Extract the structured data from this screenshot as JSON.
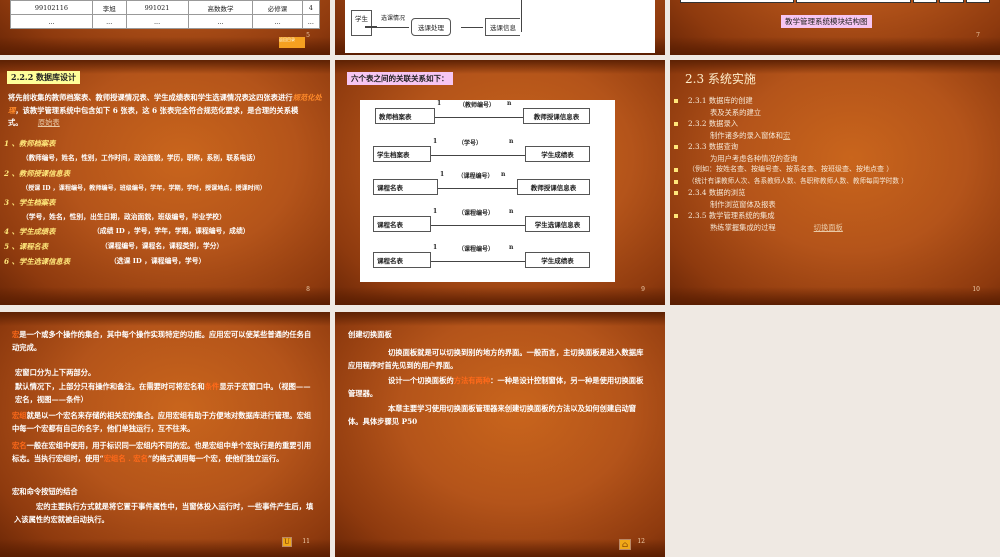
{
  "slide5": {
    "number": "5",
    "table_row1": [
      "99102116",
      "李旭",
      "991021",
      "高数数学",
      "必修课",
      "4"
    ],
    "table_row2": [
      "...",
      "...",
      "...",
      "...",
      "...",
      "..."
    ],
    "back_button": "返回目录"
  },
  "slide6": {
    "student": "学生",
    "flow1": "选课情况",
    "process": "选课处理",
    "store": "选课信息"
  },
  "slide7": {
    "number": "7",
    "caption": "教学管理系统模块结构图"
  },
  "slide8": {
    "number": "8",
    "title": "2.2.2  数据库设计",
    "intro_a": "将先前收集的教师档案表、教师授课情况表、学生成绩表和学生选课情况表这四张表进行",
    "intro_em": "规范化处理",
    "intro_b": "，该教学管理系统中包含如下 6 张表，这 6 张表完全符合规范化要求，是合理的关系模式。",
    "link": "原始表",
    "tables": [
      {
        "name": "1 、教师档案表",
        "fields": "（教师编号，姓名，性别，工作时间，政治面貌，学历，职称，系别，联系电话）"
      },
      {
        "name": "2 、教师授课信息表",
        "fields": "（授课 ID ，课程编号，教师编号，班级编号，学年，学期，学时，授课地点，授课时间）"
      },
      {
        "name": "3 、学生档案表",
        "fields": "（学号，姓名，性别，出生日期，政治面貌，班级编号，毕业学校）"
      },
      {
        "name": "4 、学生成绩表",
        "fields": "（成绩 ID ，学号，学年，学期，课程编号，成绩）"
      },
      {
        "name": "5 、课程名表",
        "fields": "（课程编号，课程名，课程类别，学分）"
      },
      {
        "name": "6 、学生选课信息表",
        "fields": "（选课 ID ，课程编号，学号）"
      }
    ]
  },
  "slide9": {
    "number": "9",
    "title": "六个表之间的关联关系如下：",
    "relations": [
      {
        "from": "教师档案表",
        "one": "1",
        "key": "（教师编号）",
        "many": "n",
        "to": "教师授课信息表"
      },
      {
        "from": "学生档案表",
        "one": "1",
        "key": "（学号）",
        "many": "n",
        "to": "学生成绩表"
      },
      {
        "from": "课程名表",
        "one": "1",
        "key": "（课程编号）",
        "many": "n",
        "to": "教师授课信息表"
      },
      {
        "from": "课程名表",
        "one": "1",
        "key": "（课程编号）",
        "many": "n",
        "to": "学生选课信息表"
      },
      {
        "from": "课程名表",
        "one": "1",
        "key": "（课程编号）",
        "many": "n",
        "to": "学生成绩表"
      }
    ]
  },
  "slide10": {
    "number": "10",
    "title": "2.3  系统实施",
    "items": [
      "2.3.1   数据库的创建",
      "表及关系的建立",
      "2.3.2   数据录入",
      "制作诸多的录入窗体和",
      "宏",
      "2.3.3   数据查询",
      "为用户考虑各种情况的查询",
      "（例如：按姓名查、按编号查、按系名查、按班级查、按地点查 ）",
      "（统计有课教师人次、各系教师人数、各职称教师人数、教师每周学时数 ）",
      "2.3.4   数据的浏览",
      "制作浏览窗体及报表",
      "2.3.5   教学管理系统的集成",
      "熟练掌握集成的过程",
      "切换面板"
    ]
  },
  "slide11": {
    "number": "11",
    "p1_em": "宏",
    "p1": "是一个或多个操作的集合，其中每个操作实现特定的功能。应用宏可以使某些普通的任务自动完成。",
    "p2": "宏窗口分为上下两部分。",
    "p3_a": "默认情况下，上部分只有操作和备注。在需要时可将宏名和",
    "p3_em": "条件",
    "p3_b": "显示于宏窗口中。（视图——宏名，视图——条件）",
    "p4_em": "宏组",
    "p4": "就是以一个宏名来存储的相关宏的集合。应用宏组有助于方便地对数据库进行管理。宏组中每一个宏都有自己的名字，他们单独运行，互不往来。",
    "p5_em": "宏名",
    "p5_a": "一般在宏组中使用，用于标识同一宏组内不同的宏。也是宏组中单个宏执行是的重要引用标志。当执行宏组时，使用“",
    "p5_em2": "宏组名 . 宏名",
    "p5_b": "”的格式调用每一个宏，使他们独立运行。",
    "p6": "宏和命令按钮的结合",
    "p7": "宏的主要执行方式就是将它置于事件属性中，当窗体投入运行时，一些事件产生后，填入该属性的宏就被启动执行。"
  },
  "slide12": {
    "number": "12",
    "title": "创建切换面板",
    "p1": "切换面板就是可以切换到别的地方的界面。一般而言，主切换面板是进入数据库应用程序时首先见到的用户界面。",
    "p2_a": "设计一个切换面板的",
    "p2_em": "方法有两种",
    "p2_b": "：一种是设计控制窗体，另一种是使用切换面板管理器。",
    "p3": "本章主要学习使用切换面板管理器来创建切换面板的方法以及如何创建启动窗体。具体步骤见 P50"
  }
}
